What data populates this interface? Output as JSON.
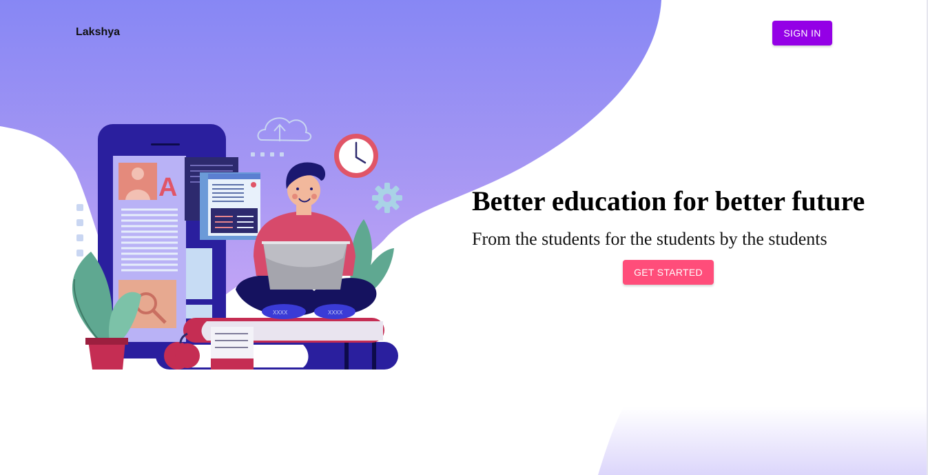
{
  "header": {
    "brand": "Lakshya",
    "signin_label": "SIGN IN"
  },
  "hero": {
    "title": "Better education for better future",
    "subtitle": "From the students for the students by the students",
    "cta_label": "GET STARTED",
    "illustration_icon": "student-laptop-illustration",
    "shoe_text": "XXXX"
  },
  "colors": {
    "blob_top": "#8a88f4",
    "blob_bottom": "#c1a4f5",
    "signin_button": "#9400e6",
    "cta_button": "#ff4d7a"
  }
}
